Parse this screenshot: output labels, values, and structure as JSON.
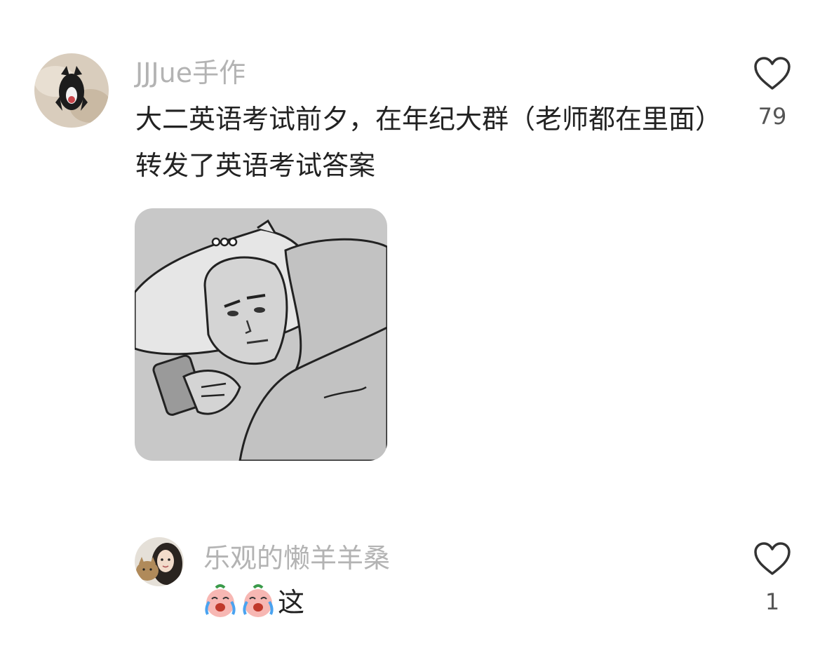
{
  "comments": [
    {
      "username": "JJJue手作",
      "text": "大二英语考试前夕，在年纪大群（老师都在里面）转发了英语考试答案",
      "likes": "79",
      "avatar_icon": "cat-photo-avatar",
      "sticker_icon": "lying-in-bed-phone-meme"
    },
    {
      "username": "乐观的懒羊羊桑",
      "emojis": [
        "crying-peach-emoji",
        "crying-peach-emoji"
      ],
      "text": "这",
      "likes": "1",
      "avatar_icon": "girl-with-cat-avatar"
    }
  ],
  "colors": {
    "username": "#b3b3b3",
    "text": "#222222",
    "like_count": "#555555",
    "sticker_bg": "#c8c8c8"
  }
}
